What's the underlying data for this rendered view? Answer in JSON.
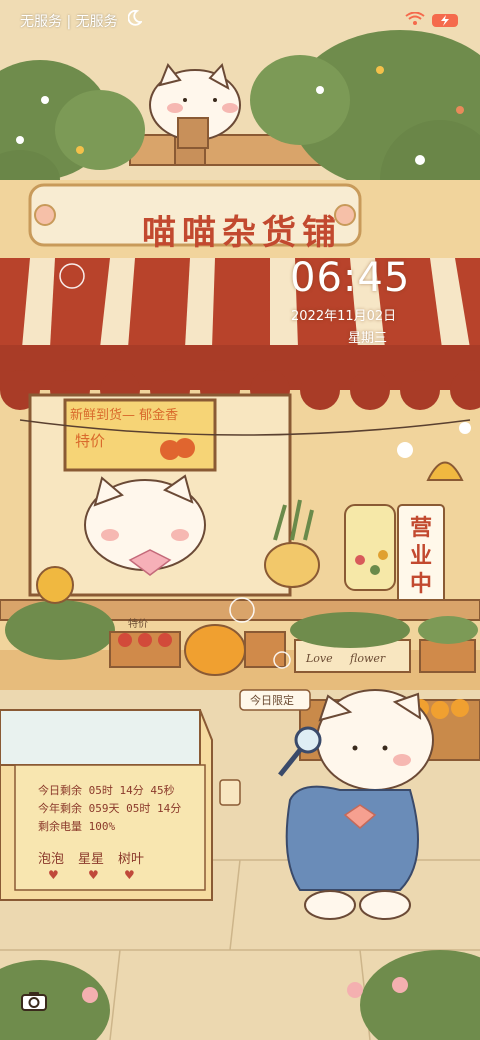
{
  "status_bar": {
    "carrier_text": "无服务 | 无服务",
    "icons": [
      "moon-icon",
      "wifi-icon",
      "charging-battery-icon"
    ],
    "battery_color": "#f56a4c"
  },
  "wallpaper": {
    "shop_sign": "喵喵杂货铺",
    "chalkboard_line1": "新鲜到货— 郁金香",
    "chalkboard_line2": "特价",
    "price_tag": "特价",
    "open_sign": "营业中",
    "today_limit_sign": "今日限定",
    "crate_label_love": "Love",
    "crate_label_flower": "flower"
  },
  "clock": {
    "time": "06:45",
    "date": "2022年11月02日",
    "weekday": "星期三"
  },
  "fridge_widget": {
    "day_remaining": "今日剩余 05时 14分 45秒",
    "year_remaining": "今年剩余 059天 05时 14分",
    "battery_remaining": "剩余电量 100%",
    "labels": [
      "泡泡",
      "星星",
      "树叶"
    ]
  },
  "lock_screen": {
    "camera_shortcut_icon": "camera-icon"
  },
  "colors": {
    "awning_red": "#b8432b",
    "awning_cream": "#f6e6c6",
    "sign_text": "#c2492f",
    "foliage": "#6a8a4a"
  }
}
